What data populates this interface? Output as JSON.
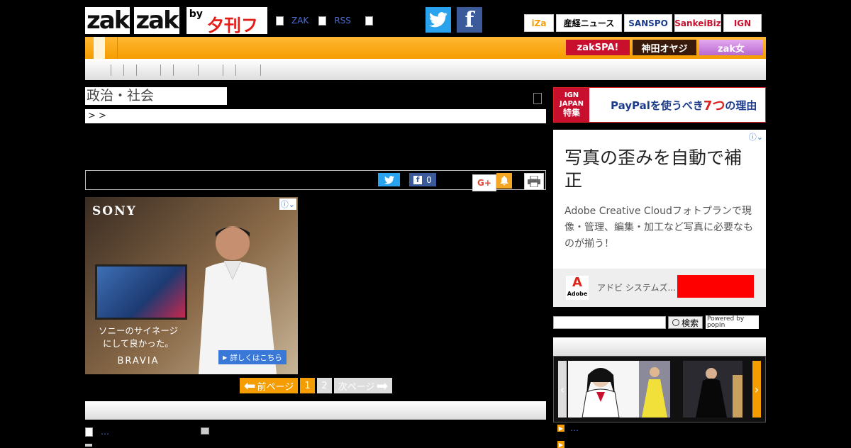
{
  "header": {
    "logo_text_a": "zak",
    "logo_text_b": "zak",
    "logo_by": "by",
    "logo_fuji": "夕刊フジ",
    "links": [
      "ZAK",
      "RSS"
    ],
    "twitter_glyph": "🐦",
    "facebook_glyph": "f",
    "partners": [
      {
        "label": "iZa",
        "color": "#f59d00"
      },
      {
        "label": "産経ニュース",
        "color": "#000000"
      },
      {
        "label": "SANSPO",
        "color": "#1c3b8a"
      },
      {
        "label": "SankeiBiz",
        "color": "#c8102e"
      },
      {
        "label": "IGN",
        "color": "#c8102e"
      }
    ]
  },
  "nav": {
    "sub_banners": [
      {
        "label": "zakSPA!",
        "bg": "#c8102e"
      },
      {
        "label": "神田オヤジ",
        "bg": "#3a1a0a"
      },
      {
        "label": "zak女",
        "bg": "#c87ad8"
      }
    ]
  },
  "main": {
    "category_title": "政治・社会",
    "breadcrumb": ">    >",
    "share": {
      "fb_count": "0",
      "gplus_label": "G+"
    },
    "pager": {
      "prev": "前ページ",
      "page1": "1",
      "page2": "2",
      "next": "次ページ"
    },
    "related": [
      {
        "label": "…"
      }
    ]
  },
  "ads": {
    "sony": {
      "logo": "SONY",
      "copy_line1": "ソニーのサイネージ",
      "copy_line2": "にして良かった。",
      "brand": "BRAVIA",
      "cta": "詳しくはこちら",
      "info": "ⓘ⌄"
    },
    "ign": {
      "left_line1": "IGN",
      "left_line2": "JAPAN",
      "left_line3": "特集",
      "text_a": "PayPalを使うべき",
      "text_num": "7つ",
      "text_b": "の理由"
    },
    "adobe": {
      "title": "写真の歪みを自動で補正",
      "description": "Adobe Creative Cloudフォトプランで現像・管理、編集・加工など写真に必要なものが揃う！",
      "logo_text": "Adobe",
      "advertiser": "アドビ システムズ...",
      "info": "ⓘ⌄"
    }
  },
  "sidebar": {
    "search_button": "検索",
    "popin_label": "Powered by popIn",
    "gallery_caption": "…"
  }
}
